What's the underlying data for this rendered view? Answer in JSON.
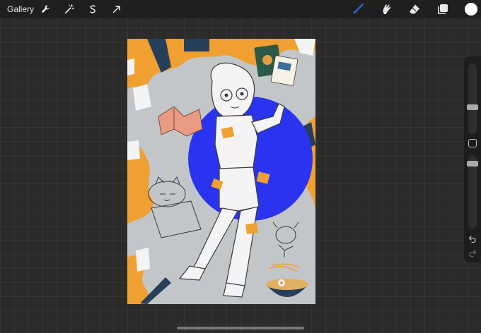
{
  "topbar": {
    "gallery_label": "Gallery",
    "left_tools": [
      "wrench-icon",
      "magic-wand-icon",
      "selection-s-icon",
      "transform-arrow-icon"
    ],
    "right_tools": [
      "brush-icon",
      "smudge-icon",
      "eraser-icon",
      "layers-icon"
    ],
    "active_tool": "brush-icon",
    "active_color": "#ffffff",
    "accent_color": "#2f6de0"
  },
  "canvas": {
    "palette": {
      "background": "#c3c6c8",
      "orange": "#f0a030",
      "blue_circle": "#2a34f0",
      "navy": "#283f5c",
      "line": "#3a3a3a"
    }
  },
  "sidebar": {
    "brush_size_level": 0.2,
    "opacity_level": 0.55,
    "icons": [
      "modifier-square-icon",
      "undo-icon",
      "redo-icon"
    ]
  }
}
